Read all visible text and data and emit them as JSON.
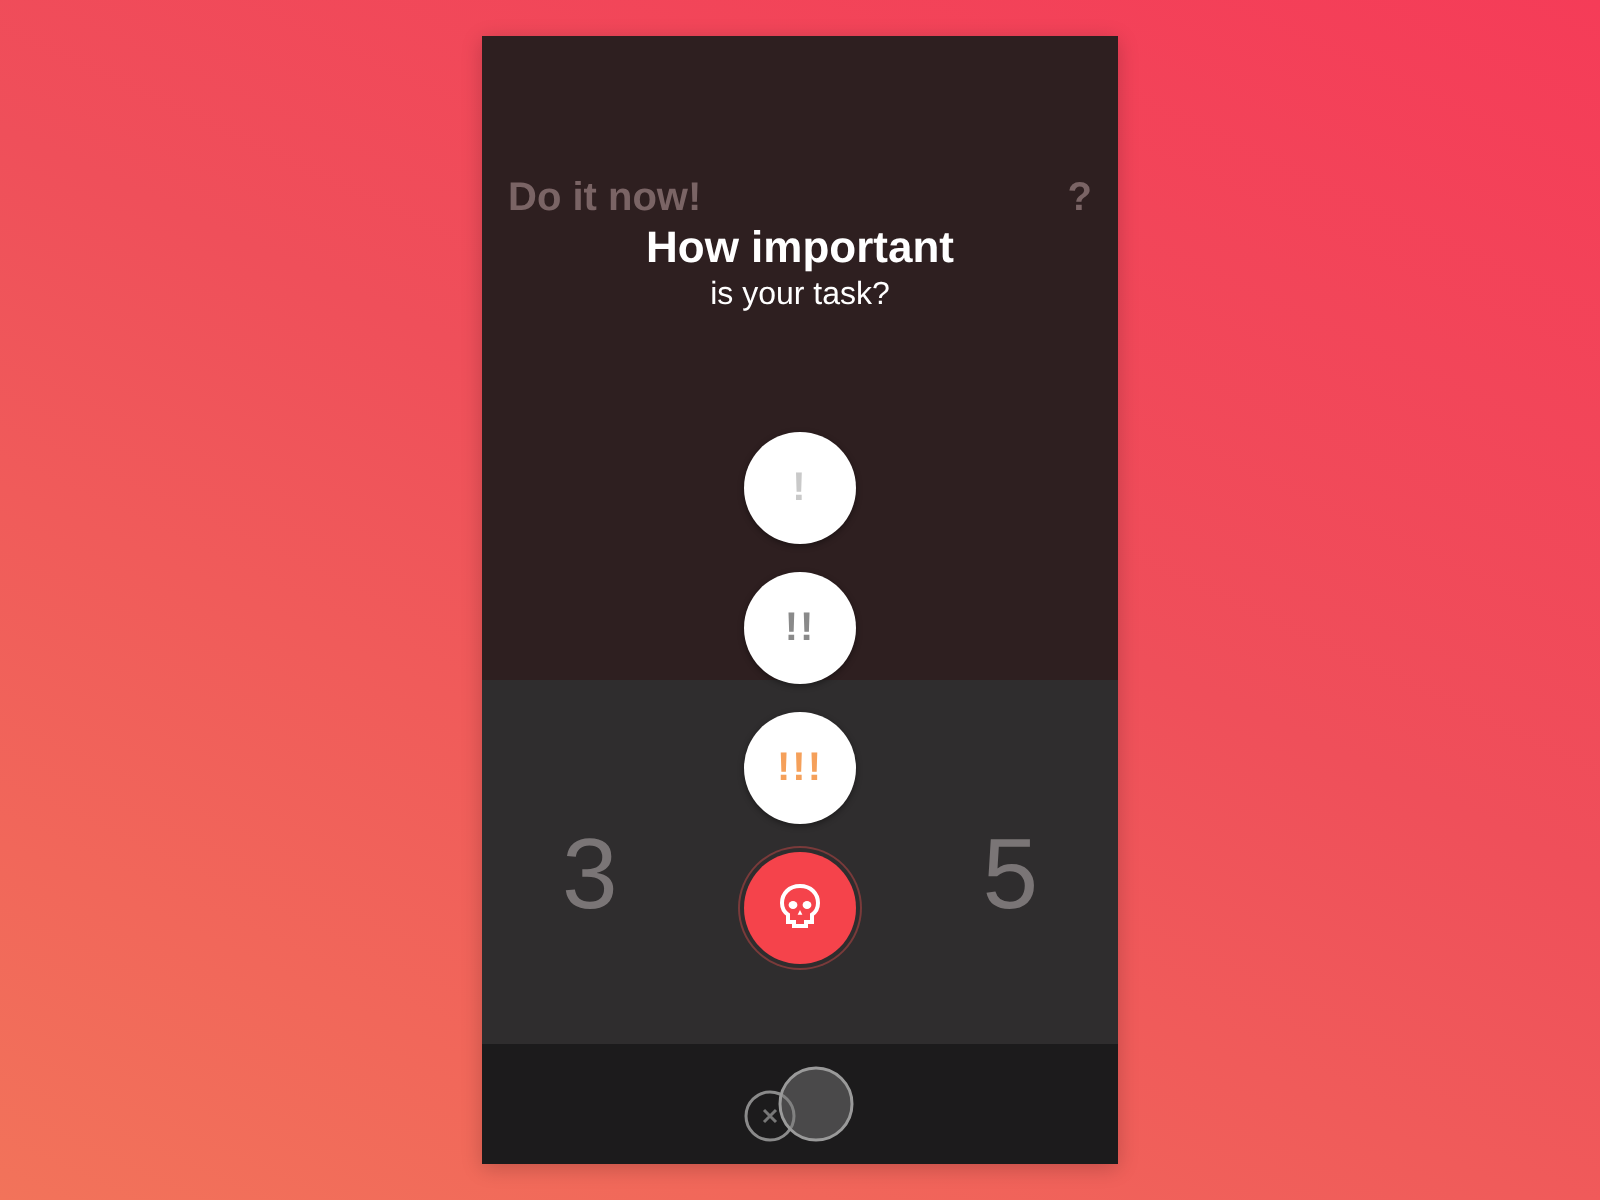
{
  "background_screen": {
    "heading": "Do it now!",
    "help": "?",
    "stats": [
      "3",
      "5"
    ]
  },
  "prompt": {
    "title": "How important",
    "subtitle": "is your task?"
  },
  "options": [
    {
      "kind": "low",
      "label": "!"
    },
    {
      "kind": "medium",
      "label": "!!"
    },
    {
      "kind": "high",
      "label": "!!!"
    },
    {
      "kind": "critical"
    }
  ]
}
